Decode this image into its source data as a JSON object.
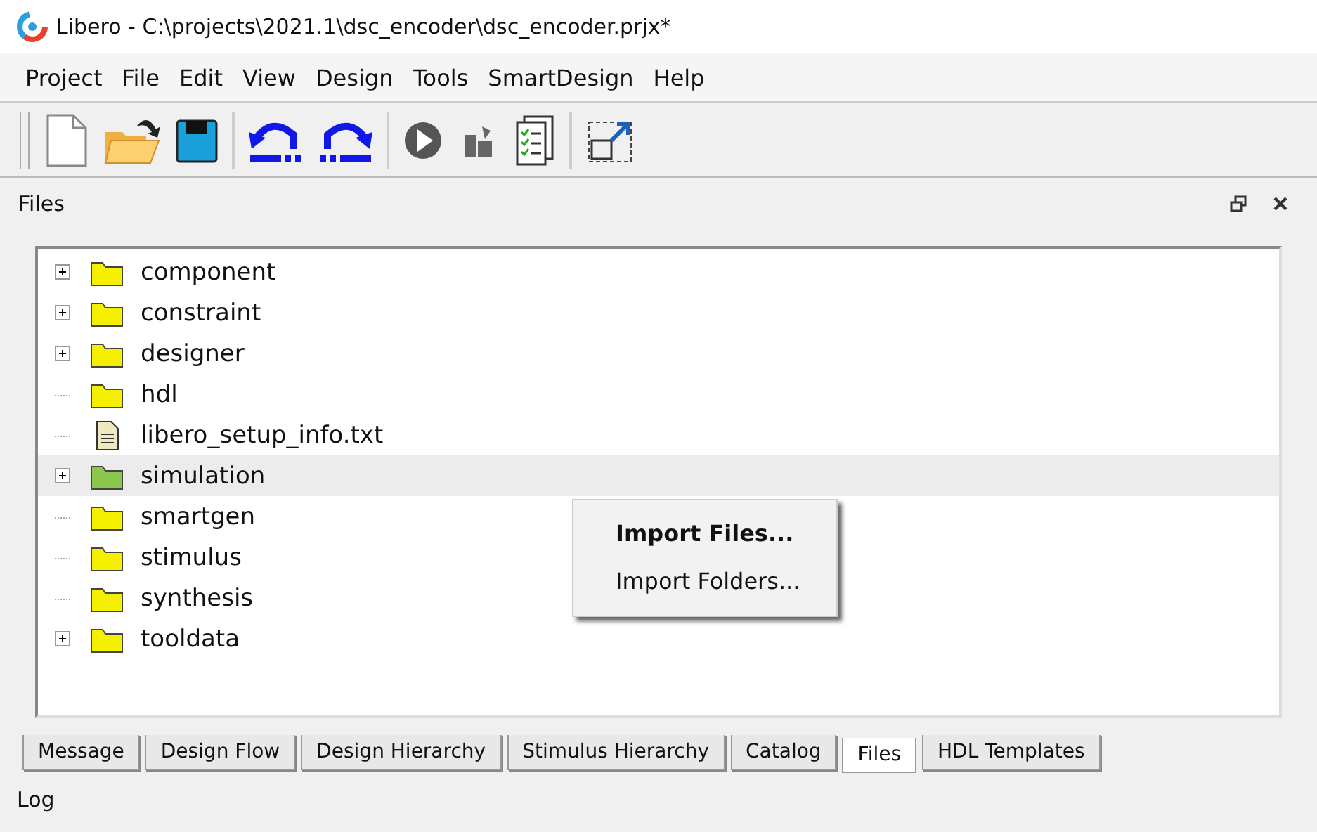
{
  "window": {
    "title": "Libero - C:\\projects\\2021.1\\dsc_encoder\\dsc_encoder.prjx*"
  },
  "menu": [
    "Project",
    "File",
    "Edit",
    "View",
    "Design",
    "Tools",
    "SmartDesign",
    "Help"
  ],
  "panel": {
    "title": "Files"
  },
  "tree": [
    {
      "label": "component",
      "kind": "folder",
      "expandable": true,
      "selected": false,
      "color": "#f5f000"
    },
    {
      "label": "constraint",
      "kind": "folder",
      "expandable": true,
      "selected": false,
      "color": "#f5f000"
    },
    {
      "label": "designer",
      "kind": "folder",
      "expandable": true,
      "selected": false,
      "color": "#f5f000"
    },
    {
      "label": "hdl",
      "kind": "folder",
      "expandable": false,
      "selected": false,
      "color": "#f5f000"
    },
    {
      "label": "libero_setup_info.txt",
      "kind": "file",
      "expandable": false,
      "selected": false
    },
    {
      "label": "simulation",
      "kind": "folder",
      "expandable": true,
      "selected": true,
      "color": "#8cc850"
    },
    {
      "label": "smartgen",
      "kind": "folder",
      "expandable": false,
      "selected": false,
      "color": "#f5f000"
    },
    {
      "label": "stimulus",
      "kind": "folder",
      "expandable": false,
      "selected": false,
      "color": "#f5f000"
    },
    {
      "label": "synthesis",
      "kind": "folder",
      "expandable": false,
      "selected": false,
      "color": "#f5f000"
    },
    {
      "label": "tooldata",
      "kind": "folder",
      "expandable": true,
      "selected": false,
      "color": "#f5f000"
    }
  ],
  "context_menu": [
    {
      "label": "Import Files...",
      "default": true
    },
    {
      "label": "Import Folders...",
      "default": false
    }
  ],
  "tabs": [
    {
      "label": "Message",
      "selected": false
    },
    {
      "label": "Design Flow",
      "selected": false
    },
    {
      "label": "Design Hierarchy",
      "selected": false
    },
    {
      "label": "Stimulus Hierarchy",
      "selected": false
    },
    {
      "label": "Catalog",
      "selected": false
    },
    {
      "label": "Files",
      "selected": true
    },
    {
      "label": "HDL Templates",
      "selected": false
    }
  ],
  "log_panel": {
    "title": "Log"
  }
}
